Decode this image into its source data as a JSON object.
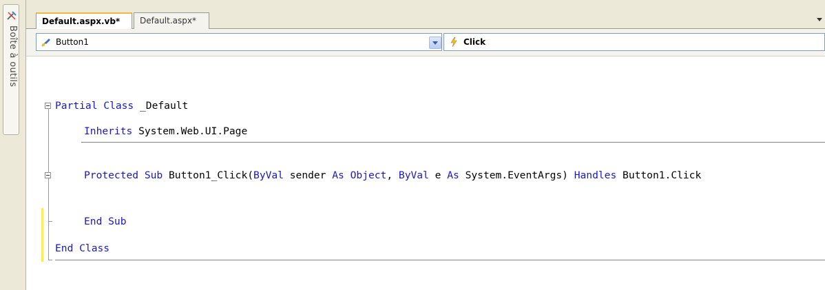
{
  "toolbox": {
    "label": "Boîte à outils",
    "icon": "toolbox-icon"
  },
  "tabs": [
    {
      "label": "Default.aspx.vb*",
      "active": true
    },
    {
      "label": "Default.aspx*",
      "active": false
    }
  ],
  "navbar": {
    "class_combo": {
      "value": "Button1",
      "icon": "control-icon"
    },
    "method_combo": {
      "value": "Click",
      "icon": "event-icon"
    }
  },
  "code": {
    "line1": {
      "kw1": "Partial Class",
      "text": " _Default"
    },
    "line2": {
      "kw1": "Inherits",
      "text": " System.Web.UI.Page"
    },
    "line3": {
      "kw1": "Protected Sub",
      "t1": " Button1_Click(",
      "kw2": "ByVal",
      "t2": " sender ",
      "kw3": "As Object",
      "t3": ", ",
      "kw4": "ByVal",
      "t4": " e ",
      "kw5": "As",
      "t5": " System.EventArgs) ",
      "kw6": "Handles",
      "t6": " Button1.Click"
    },
    "line4": {
      "kw1": "End Sub"
    },
    "line5": {
      "kw1": "End Class"
    }
  },
  "colors": {
    "keyword": "#1818c8",
    "text": "#000000",
    "change_marker": "#ffea5a",
    "active_tab_accent": "#f0b840"
  }
}
